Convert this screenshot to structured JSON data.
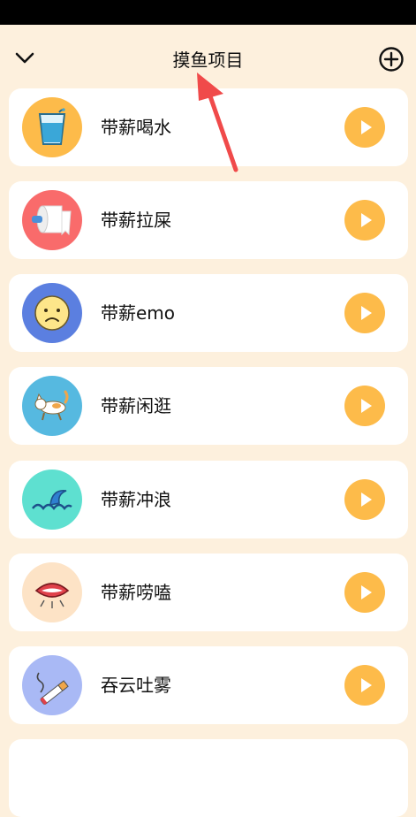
{
  "header": {
    "title": "摸鱼项目"
  },
  "items": [
    {
      "label": "带薪喝水",
      "icon": "water-glass-icon",
      "bg": "#fdbb4a"
    },
    {
      "label": "带薪拉屎",
      "icon": "toilet-paper-icon",
      "bg": "#f96b6b"
    },
    {
      "label": "带薪emo",
      "icon": "sad-face-icon",
      "bg": "#5b7fe0"
    },
    {
      "label": "带薪闲逛",
      "icon": "cat-icon",
      "bg": "#56b9e0"
    },
    {
      "label": "带薪冲浪",
      "icon": "wave-icon",
      "bg": "#5ee0d0"
    },
    {
      "label": "带薪唠嗑",
      "icon": "mouth-icon",
      "bg": "#fde3c6"
    },
    {
      "label": "吞云吐雾",
      "icon": "cigarette-icon",
      "bg": "#a9b9f5"
    }
  ]
}
